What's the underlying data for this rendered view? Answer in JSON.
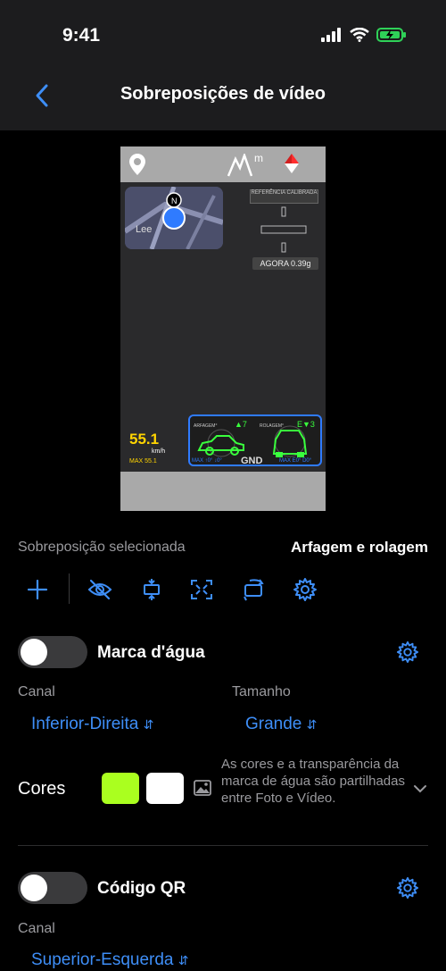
{
  "status": {
    "time": "9:41"
  },
  "nav": {
    "title": "Sobreposições de vídeo"
  },
  "preview": {
    "ref_label": "REFERÊNCIA CALIBRADA",
    "agora": "AGORA 0.39g",
    "speed": "55.1",
    "speed_unit": "km/h",
    "speed_max": "MAX 55.1",
    "pitch_label": "ARFAGEM°",
    "pitch_value": "▲7",
    "roll_label": "ROLAGEM°",
    "roll_value": "E▼3",
    "gnd": "GND",
    "max_left": "MAX ↑0° ↓0°",
    "max_right": "MAX E0° D0°",
    "altitude_unit": "m",
    "map_text": "Lee"
  },
  "selected": {
    "label": "Sobreposição selecionada",
    "value": "Arfagem e rolagem"
  },
  "toolbar": {
    "icons": [
      "add-icon",
      "hide-icon",
      "align-vertical-icon",
      "fullscreen-icon",
      "rotate-icon",
      "gear-icon"
    ]
  },
  "watermark": {
    "title": "Marca d'água",
    "channel_label": "Canal",
    "channel_value": "Inferior-Direita",
    "size_label": "Tamanho",
    "size_value": "Grande",
    "colors_label": "Cores",
    "color_1": "#aaff1f",
    "color_2": "#ffffff",
    "info": "As cores e a transparência da marca de água são partilhadas entre Foto e Vídeo."
  },
  "qr": {
    "title": "Código QR",
    "channel_label": "Canal",
    "channel_value": "Superior-Esquerda"
  },
  "colors": {
    "accent": "#3e8ef7"
  }
}
